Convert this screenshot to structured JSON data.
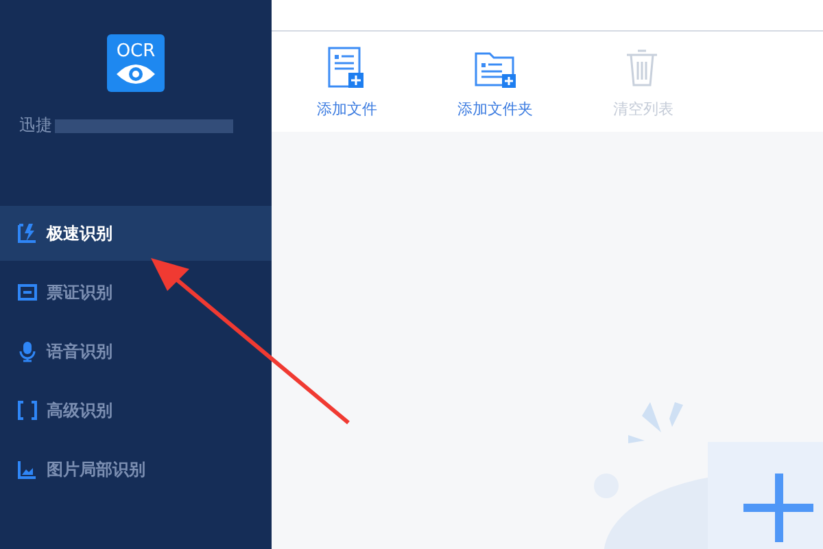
{
  "app": {
    "logo_text": "OCR",
    "name": "迅捷"
  },
  "sidebar": {
    "items": [
      {
        "label": "极速识别",
        "kind": "bolt",
        "selected": true
      },
      {
        "label": "票证识别",
        "kind": "card",
        "selected": false
      },
      {
        "label": "语音识别",
        "kind": "mic",
        "selected": false
      },
      {
        "label": "高级识别",
        "kind": "frame",
        "selected": false
      },
      {
        "label": "图片局部识别",
        "kind": "image",
        "selected": false
      }
    ]
  },
  "toolbar": [
    {
      "label": "添加文件",
      "kind": "file",
      "disabled": false
    },
    {
      "label": "添加文件夹",
      "kind": "folder",
      "disabled": false
    },
    {
      "label": "清空列表",
      "kind": "trash",
      "disabled": true
    }
  ]
}
